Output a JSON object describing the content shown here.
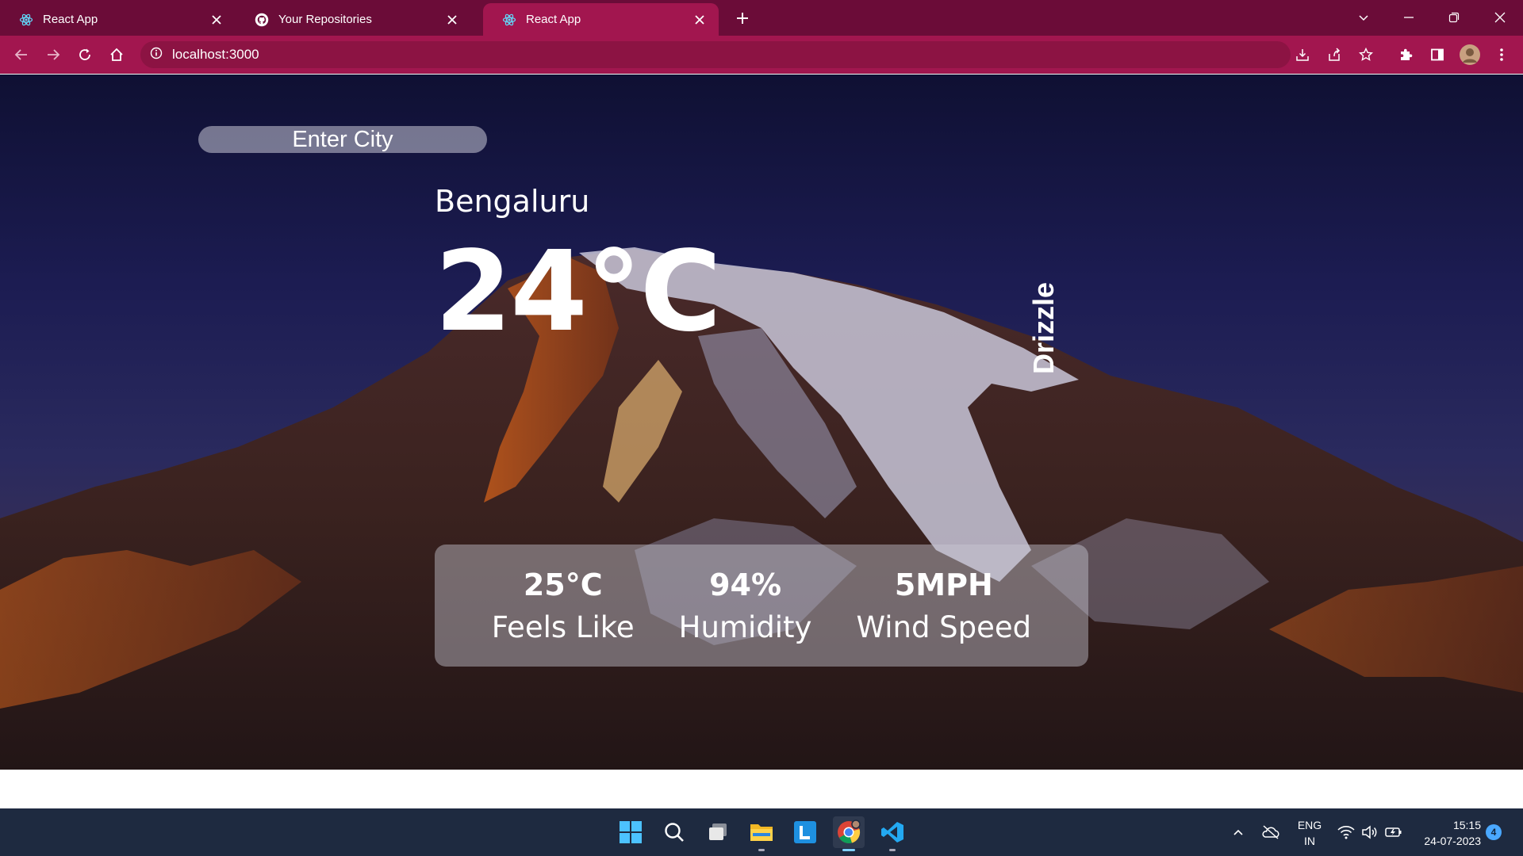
{
  "browser": {
    "tabs": [
      {
        "title": "React App",
        "icon": "react-icon",
        "active": false
      },
      {
        "title": "Your Repositories",
        "icon": "github-icon",
        "active": false
      },
      {
        "title": "React App",
        "icon": "react-icon",
        "active": true
      }
    ],
    "url": "localhost:3000",
    "theme_color": "#a2164f",
    "tabbar_color": "#6b0c38"
  },
  "weather": {
    "search": {
      "placeholder": "Enter City",
      "value": ""
    },
    "city": "Bengaluru",
    "temperature": "24°C",
    "condition": "Drizzle",
    "stats": [
      {
        "value": "25°C",
        "label": "Feels Like"
      },
      {
        "value": "94%",
        "label": "Humidity"
      },
      {
        "value": "5MPH",
        "label": "Wind Speed"
      }
    ]
  },
  "taskbar": {
    "apps": [
      "windows-start-icon",
      "search-icon",
      "task-view-icon",
      "file-explorer-icon",
      "l-app-icon",
      "chrome-icon",
      "vscode-icon"
    ],
    "language": {
      "line1": "ENG",
      "line2": "IN"
    },
    "time": "15:15",
    "date": "24-07-2023",
    "notifications": "4"
  }
}
